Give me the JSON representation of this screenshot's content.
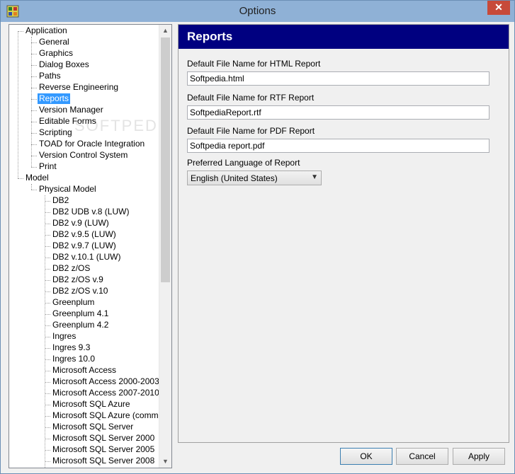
{
  "window": {
    "title": "Options",
    "close_label": "✕"
  },
  "tree": {
    "items": [
      {
        "label": "Application"
      },
      {
        "label": "General"
      },
      {
        "label": "Graphics"
      },
      {
        "label": "Dialog Boxes"
      },
      {
        "label": "Paths"
      },
      {
        "label": "Reverse Engineering"
      },
      {
        "label": "Reports"
      },
      {
        "label": "Version Manager"
      },
      {
        "label": "Editable Forms"
      },
      {
        "label": "Scripting"
      },
      {
        "label": "TOAD for Oracle Integration"
      },
      {
        "label": "Version Control System"
      },
      {
        "label": "Print"
      },
      {
        "label": "Model"
      },
      {
        "label": "Physical Model"
      },
      {
        "label": "DB2"
      },
      {
        "label": "DB2 UDB v.8 (LUW)"
      },
      {
        "label": "DB2 v.9 (LUW)"
      },
      {
        "label": "DB2 v.9.5 (LUW)"
      },
      {
        "label": "DB2 v.9.7 (LUW)"
      },
      {
        "label": "DB2 v.10.1 (LUW)"
      },
      {
        "label": "DB2 z/OS"
      },
      {
        "label": "DB2 z/OS v.9"
      },
      {
        "label": "DB2 z/OS v.10"
      },
      {
        "label": "Greenplum"
      },
      {
        "label": "Greenplum 4.1"
      },
      {
        "label": "Greenplum 4.2"
      },
      {
        "label": "Ingres"
      },
      {
        "label": "Ingres 9.3"
      },
      {
        "label": "Ingres 10.0"
      },
      {
        "label": "Microsoft Access"
      },
      {
        "label": "Microsoft Access 2000-2003"
      },
      {
        "label": "Microsoft Access 2007-2010"
      },
      {
        "label": "Microsoft SQL Azure"
      },
      {
        "label": "Microsoft SQL Azure (common)"
      },
      {
        "label": "Microsoft SQL Server"
      },
      {
        "label": "Microsoft SQL Server 2000"
      },
      {
        "label": "Microsoft SQL Server 2005"
      },
      {
        "label": "Microsoft SQL Server 2008"
      }
    ],
    "selected": "Reports",
    "watermark": "SOFTPEDIA"
  },
  "reports": {
    "header": "Reports",
    "html_label": "Default File Name for HTML Report",
    "html_value": "Softpedia.html",
    "rtf_label": "Default File Name for RTF Report",
    "rtf_value": "SoftpediaReport.rtf",
    "pdf_label": "Default File Name for PDF Report",
    "pdf_value": "Softpedia report.pdf",
    "language_label": "Preferred Language of Report",
    "language_value": "English (United States)"
  },
  "buttons": {
    "ok": "OK",
    "cancel": "Cancel",
    "apply": "Apply"
  },
  "colors": {
    "header_band": "#000080",
    "selection": "#3399ff",
    "titlebar": "#8fb1d6",
    "close": "#c74a3a"
  }
}
